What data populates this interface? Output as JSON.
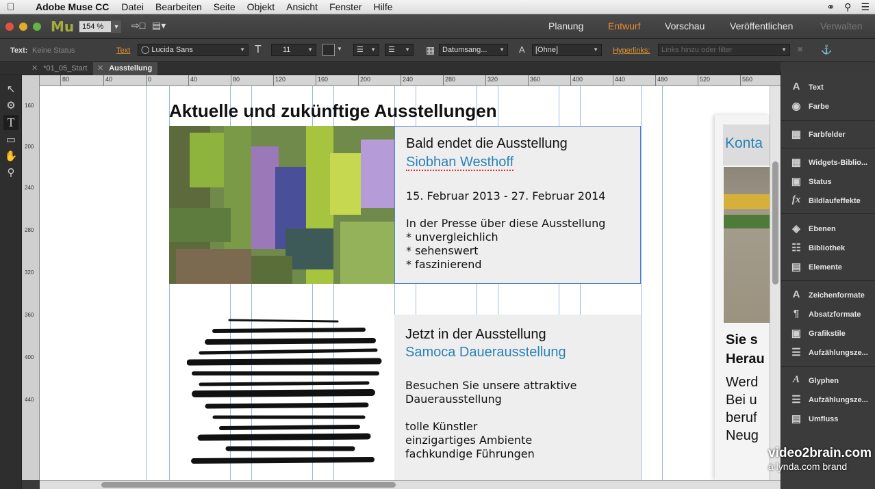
{
  "menubar": {
    "app_name": "Adobe Muse CC",
    "items": [
      "Datei",
      "Bearbeiten",
      "Seite",
      "Objekt",
      "Ansicht",
      "Fenster",
      "Hilfe"
    ]
  },
  "toolbar_top": {
    "logo": "Mu",
    "zoom": "154 %",
    "modes": [
      "Planung",
      "Entwurf",
      "Vorschau",
      "Veröffentlichen",
      "Verwalten"
    ],
    "active_mode": "Entwurf"
  },
  "control_bar": {
    "label_text": "Text:",
    "status": "Keine Status",
    "text_link": "Text",
    "font": "Lucida Sans",
    "size": "11",
    "date_field": "Datumsang...",
    "style_field": "[Ohne]",
    "hyperlinks_label": "Hyperlinks:",
    "hyperlinks_placeholder": "Links hinzu oder filter"
  },
  "tabs": [
    {
      "label": "*01_05_Start",
      "active": false
    },
    {
      "label": "Ausstellung",
      "active": true
    }
  ],
  "ruler": {
    "h_ticks": [
      "80",
      "40",
      "0",
      "40",
      "80",
      "120",
      "160",
      "200",
      "240",
      "280",
      "320",
      "360",
      "400",
      "440",
      "480",
      "520",
      "560"
    ],
    "v_ticks": [
      "160",
      "200",
      "240",
      "280",
      "320",
      "360",
      "400",
      "440"
    ]
  },
  "page": {
    "title": "Aktuelle und zukünftige Ausstellungen",
    "card1": {
      "heading": "Bald endet die Ausstellung",
      "artist": "Siobhan Westhoff",
      "dates": "15. Februar 2013 - 27. Februar 2014",
      "press": "In der Presse über diese Ausstellung\n* unvergleichlich\n* sehenswert\n* faszinierend"
    },
    "card2": {
      "heading": "Jetzt in der Ausstellung",
      "artist": "Samoca Dauerausstellung",
      "text1": "Besuchen Sie unsere attraktive\nDauerausstellung",
      "text2": "tolle Künstler\neinzigartiges Ambiente\nfachkundige Führungen"
    },
    "sidebar": {
      "kontakt": "Konta",
      "heading_lines": [
        "Sie s",
        "Herau"
      ],
      "text_lines": [
        "Werd",
        "Bei u",
        "beruf",
        "Neug"
      ]
    }
  },
  "panel": {
    "items": [
      "Text",
      "Farbe",
      "Farbfelder",
      "Widgets-Biblio...",
      "Status",
      "Bildlaufeffekte",
      "Ebenen",
      "Bibliothek",
      "Elemente",
      "Zeichenformate",
      "Absatzformate",
      "Grafikstile",
      "Aufzählungsze...",
      "Glyphen",
      "Aufzählungsze...",
      "Umfluss"
    ]
  },
  "watermark": {
    "line1": "video2brain.com",
    "line2": "a lynda.com brand"
  }
}
